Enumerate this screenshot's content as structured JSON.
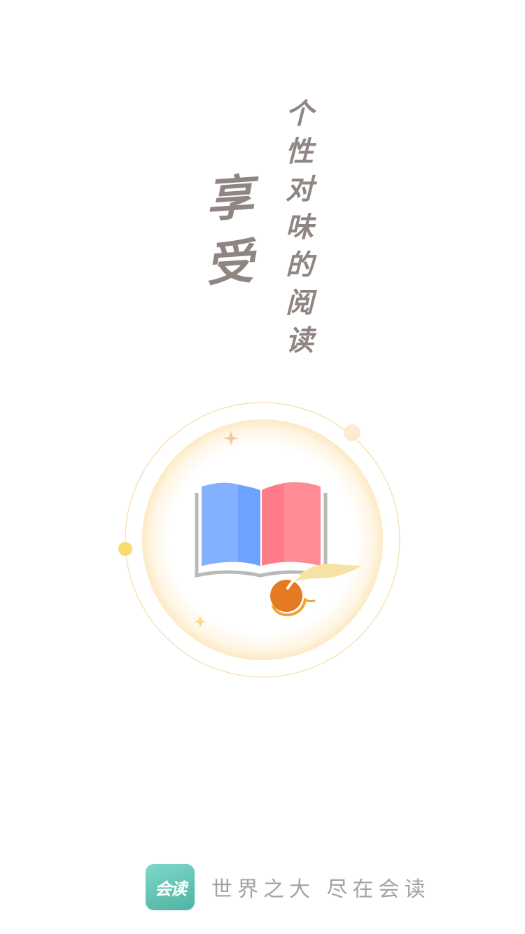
{
  "slogan": {
    "big_chars": [
      "享",
      "受"
    ],
    "small_chars": [
      "个",
      "性",
      "对",
      "味",
      "的",
      "阅",
      "读"
    ]
  },
  "illustration": {
    "name": "open-book-illustration",
    "colors": {
      "left_page": "#6ea2ff",
      "right_page": "#ff7b87",
      "ring": "#f6dcab",
      "dot": "#f8dc6e",
      "orange": "#e67a22",
      "tail": "#f6e3a3",
      "spine": "#b9b9b9"
    }
  },
  "footer": {
    "logo_text": "会读",
    "tagline": "世界之大 尽在会读"
  }
}
